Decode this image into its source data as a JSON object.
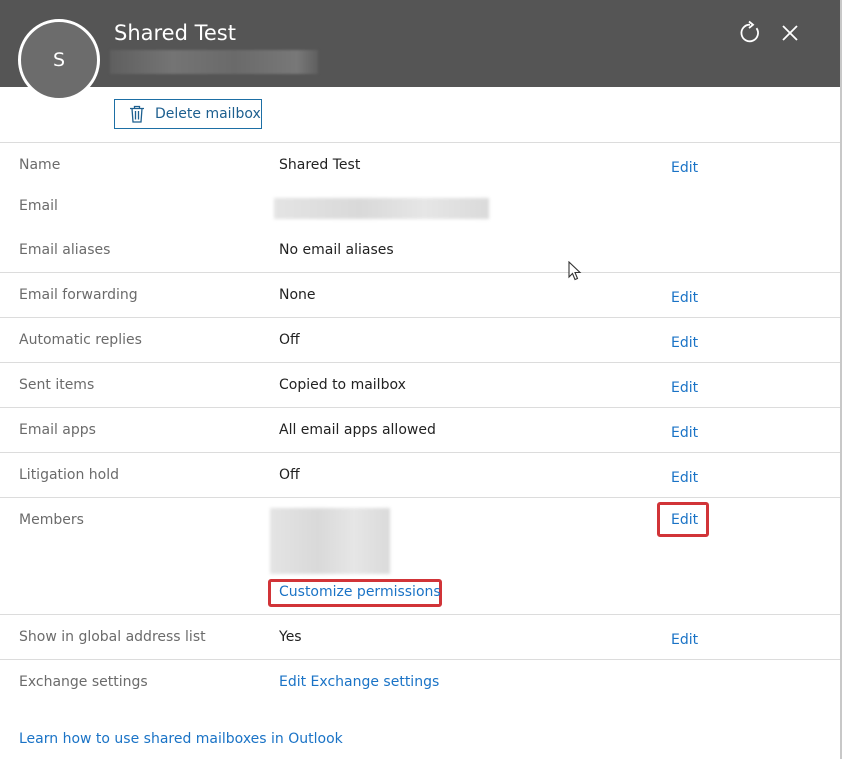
{
  "header": {
    "avatar_initial": "S",
    "title": "Shared Test",
    "refresh_icon": "refresh-icon",
    "close_icon": "close-icon"
  },
  "toolbar": {
    "delete_label": "Delete mailbox",
    "delete_icon": "trash-icon"
  },
  "rows": {
    "name": {
      "label": "Name",
      "value": "Shared Test",
      "edit": "Edit"
    },
    "email": {
      "label": "Email"
    },
    "aliases": {
      "label": "Email aliases",
      "value": "No email aliases"
    },
    "forwarding": {
      "label": "Email forwarding",
      "value": "None",
      "edit": "Edit"
    },
    "auto_replies": {
      "label": "Automatic replies",
      "value": "Off",
      "edit": "Edit"
    },
    "sent_items": {
      "label": "Sent items",
      "value": "Copied to mailbox",
      "edit": "Edit"
    },
    "email_apps": {
      "label": "Email apps",
      "value": "All email apps allowed",
      "edit": "Edit"
    },
    "litigation": {
      "label": "Litigation hold",
      "value": "Off",
      "edit": "Edit"
    },
    "members": {
      "label": "Members",
      "edit": "Edit",
      "customize_link": "Customize permissions"
    },
    "gal": {
      "label": "Show in global address list",
      "value": "Yes",
      "edit": "Edit"
    },
    "exchange": {
      "label": "Exchange settings",
      "link": "Edit Exchange settings"
    }
  },
  "footer": {
    "learn_link": "Learn how to use shared mailboxes in Outlook"
  },
  "colors": {
    "header_bg": "#555555",
    "link": "#1a73c6",
    "highlight": "#d13438"
  }
}
